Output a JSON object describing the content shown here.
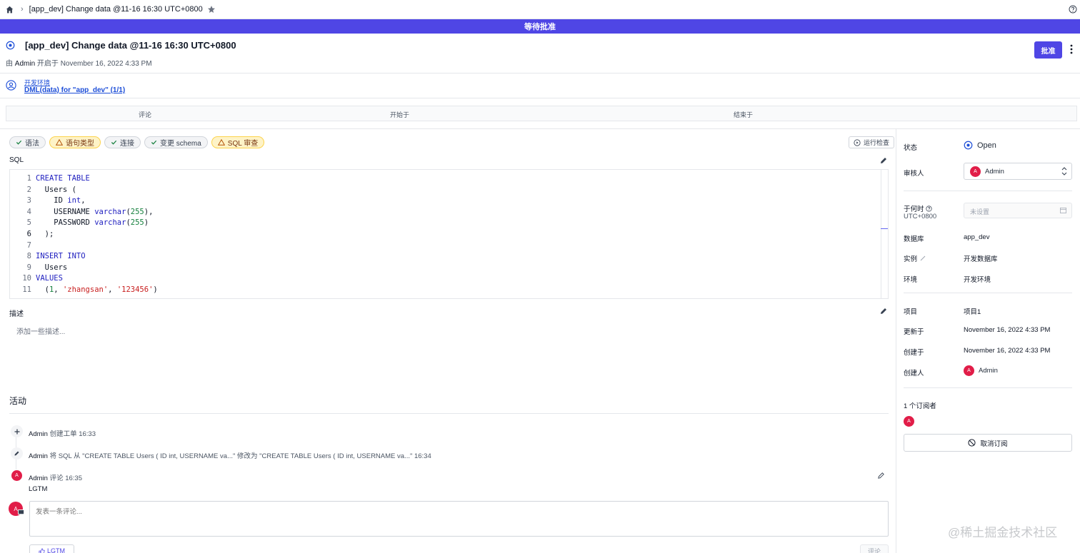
{
  "topbar": {
    "issue_title": "[app_dev] Change data @11-16 16:30 UTC+0800"
  },
  "banner": {
    "text": "等待批准"
  },
  "header": {
    "title": "[app_dev] Change data @11-16 16:30 UTC+0800",
    "by_prefix": "由",
    "creator": "Admin",
    "opened_text": "开启于 November 16, 2022 4:33 PM",
    "approve_label": "批准"
  },
  "pipeline": {
    "environment": "开发环境",
    "task": "DML(data) for \"app_dev\" (1/1)"
  },
  "task_table": {
    "col_review": "评论",
    "col_start": "开始于",
    "col_end": "结束于"
  },
  "checks": [
    {
      "label": "语法",
      "status": "success"
    },
    {
      "label": "语句类型",
      "status": "warning"
    },
    {
      "label": "连接",
      "status": "success"
    },
    {
      "label": "变更 schema",
      "status": "success"
    },
    {
      "label": "SQL 审查",
      "status": "warning"
    }
  ],
  "run_check_label": "运行检查",
  "sql_label": "SQL",
  "sql_lines": [
    {
      "n": "1",
      "parts": [
        [
          "kw",
          "CREATE TABLE"
        ]
      ]
    },
    {
      "n": "2",
      "parts": [
        [
          "",
          "  Users ("
        ]
      ]
    },
    {
      "n": "3",
      "parts": [
        [
          "",
          "    ID "
        ],
        [
          "kw",
          "int"
        ],
        [
          "",
          ","
        ]
      ]
    },
    {
      "n": "4",
      "parts": [
        [
          "",
          "    USERNAME "
        ],
        [
          "kw",
          "varchar"
        ],
        [
          "",
          "("
        ],
        [
          "num",
          "255"
        ],
        [
          "",
          "),"
        ]
      ]
    },
    {
      "n": "5",
      "parts": [
        [
          "",
          "    PASSWORD "
        ],
        [
          "kw",
          "varchar"
        ],
        [
          "",
          "("
        ],
        [
          "num",
          "255"
        ],
        [
          "",
          ")"
        ]
      ]
    },
    {
      "n": "6",
      "parts": [
        [
          "",
          "  );"
        ]
      ]
    },
    {
      "n": "7",
      "parts": [
        [
          "",
          ""
        ]
      ]
    },
    {
      "n": "8",
      "parts": [
        [
          "kw",
          "INSERT INTO"
        ]
      ]
    },
    {
      "n": "9",
      "parts": [
        [
          "",
          "  Users"
        ]
      ]
    },
    {
      "n": "10",
      "parts": [
        [
          "kw",
          "VALUES"
        ]
      ]
    },
    {
      "n": "11",
      "parts": [
        [
          "",
          "  ("
        ],
        [
          "num",
          "1"
        ],
        [
          "",
          ", "
        ],
        [
          "str",
          "'zhangsan'"
        ],
        [
          "",
          ", "
        ],
        [
          "str",
          "'123456'"
        ],
        [
          "",
          ")"
        ]
      ]
    }
  ],
  "description": {
    "label": "描述",
    "placeholder": "添加一些描述..."
  },
  "activity": {
    "title": "活动",
    "items": [
      {
        "who": "Admin",
        "text": "创建工单 16:33"
      },
      {
        "who": "Admin",
        "text": "将 SQL 从 \"CREATE TABLE Users ( ID int, USERNAME va...\" 修改为 \"CREATE TABLE Users ( ID int, USERNAME va...\" 16:34"
      },
      {
        "who": "Admin",
        "text": "评论 16:35"
      }
    ],
    "comment_body": "LGTM",
    "comment_placeholder": "发表一条评论...",
    "lgtm_label": "LGTM",
    "comment_button": "评论"
  },
  "sidebar": {
    "status_label": "状态",
    "status_value": "Open",
    "reviewer_label": "审核人",
    "reviewer_value": "Admin",
    "when_label": "于何时",
    "timezone": "UTC+0800",
    "when_placeholder": "未设置",
    "database_label": "数据库",
    "database_value": "app_dev",
    "instance_label": "实例",
    "instance_value": "开发数据库",
    "environment_label": "环境",
    "environment_value": "开发环境",
    "project_label": "项目",
    "project_value": "项目1",
    "updated_label": "更新于",
    "updated_value": "November 16, 2022 4:33 PM",
    "created_label": "创建于",
    "created_value": "November 16, 2022 4:33 PM",
    "creator_label": "创建人",
    "creator_value": "Admin",
    "subscribers_label": "1 个订阅者",
    "unsubscribe_label": "取消订阅"
  },
  "avatar_initial": "A",
  "watermark": "@稀土掘金技术社区",
  "colors": {
    "accent": "#4f46e5",
    "avatar": "#e11d48",
    "warning_bg": "#fef3c7",
    "link": "#1d4ed8"
  }
}
